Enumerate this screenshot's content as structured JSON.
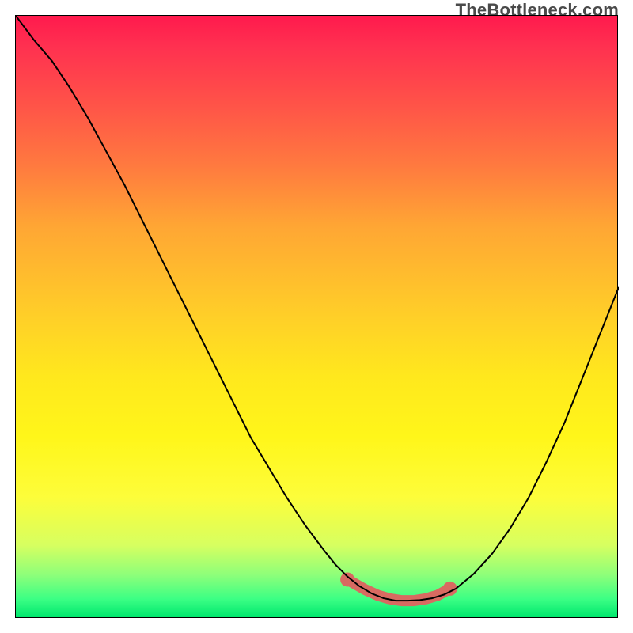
{
  "watermark": "TheBottleneck.com",
  "chart_data": {
    "type": "line",
    "title": "",
    "xlabel": "",
    "ylabel": "",
    "xlim": [
      0,
      100
    ],
    "ylim": [
      0,
      100
    ],
    "grid": false,
    "series": [
      {
        "name": "bottleneck-curve",
        "x": [
          0,
          3,
          6,
          9,
          12,
          15,
          18,
          21,
          24,
          27,
          30,
          33,
          36,
          39,
          42,
          45,
          48,
          51,
          53,
          55,
          57,
          59,
          61,
          63,
          65,
          67,
          69,
          71,
          73,
          76,
          79,
          82,
          85,
          88,
          91,
          94,
          97,
          100
        ],
        "y": [
          100,
          96,
          92.5,
          88,
          83,
          77.5,
          72,
          66,
          60,
          54,
          48,
          42,
          36,
          30,
          25,
          20,
          15.5,
          11.5,
          9,
          7,
          5.4,
          4.2,
          3.4,
          3.0,
          3.0,
          3.1,
          3.4,
          4.0,
          5.0,
          7.5,
          10.8,
          15,
          20,
          26,
          32.5,
          40,
          47.5,
          55
        ]
      },
      {
        "name": "optimal-range-highlight",
        "x": [
          55,
          58,
          60,
          62,
          64,
          66,
          68,
          70,
          72
        ],
        "y": [
          6.5,
          4.8,
          3.9,
          3.3,
          3.0,
          3.0,
          3.3,
          3.9,
          5.0
        ]
      }
    ],
    "annotations": [
      {
        "text": "watermark: TheBottleneck.com",
        "pos": "top-right"
      }
    ]
  }
}
